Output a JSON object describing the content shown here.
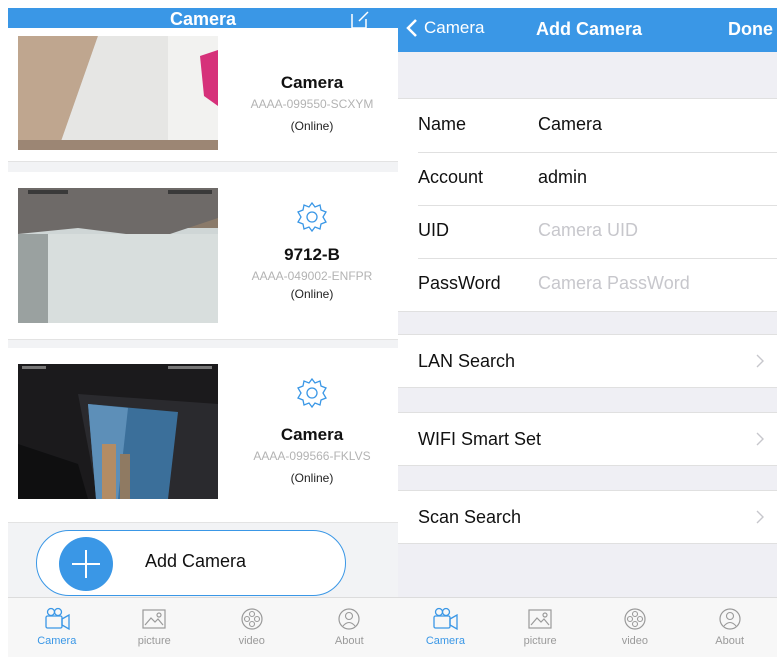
{
  "left": {
    "header_title": "Camera",
    "cameras": [
      {
        "name": "Camera",
        "uid": "AAAA-099550-SCXYM",
        "status": "(Online)"
      },
      {
        "name": "9712-B",
        "uid": "AAAA-049002-ENFPR",
        "status": "(Online)"
      },
      {
        "name": "Camera",
        "uid": "AAAA-099566-FKLVS",
        "status": "(Online)"
      }
    ],
    "add_camera_label": "Add Camera",
    "tabs": [
      {
        "label": "Camera",
        "icon": "video-camera-icon"
      },
      {
        "label": "picture",
        "icon": "picture-icon"
      },
      {
        "label": "video",
        "icon": "film-reel-icon"
      },
      {
        "label": "About",
        "icon": "person-icon"
      }
    ]
  },
  "right": {
    "back_label": "Camera",
    "title": "Add Camera",
    "done_label": "Done",
    "form": {
      "name_label": "Name",
      "name_value": "Camera",
      "account_label": "Account",
      "account_value": "admin",
      "uid_label": "UID",
      "uid_placeholder": "Camera UID",
      "password_label": "PassWord",
      "password_placeholder": "Camera PassWord"
    },
    "lan_search": "LAN Search",
    "wifi_smart_set": "WIFI Smart Set",
    "scan_search": "Scan Search"
  },
  "colors": {
    "accent": "#3a97e6",
    "background": "#efeff4",
    "placeholder": "#c7c7cc"
  }
}
